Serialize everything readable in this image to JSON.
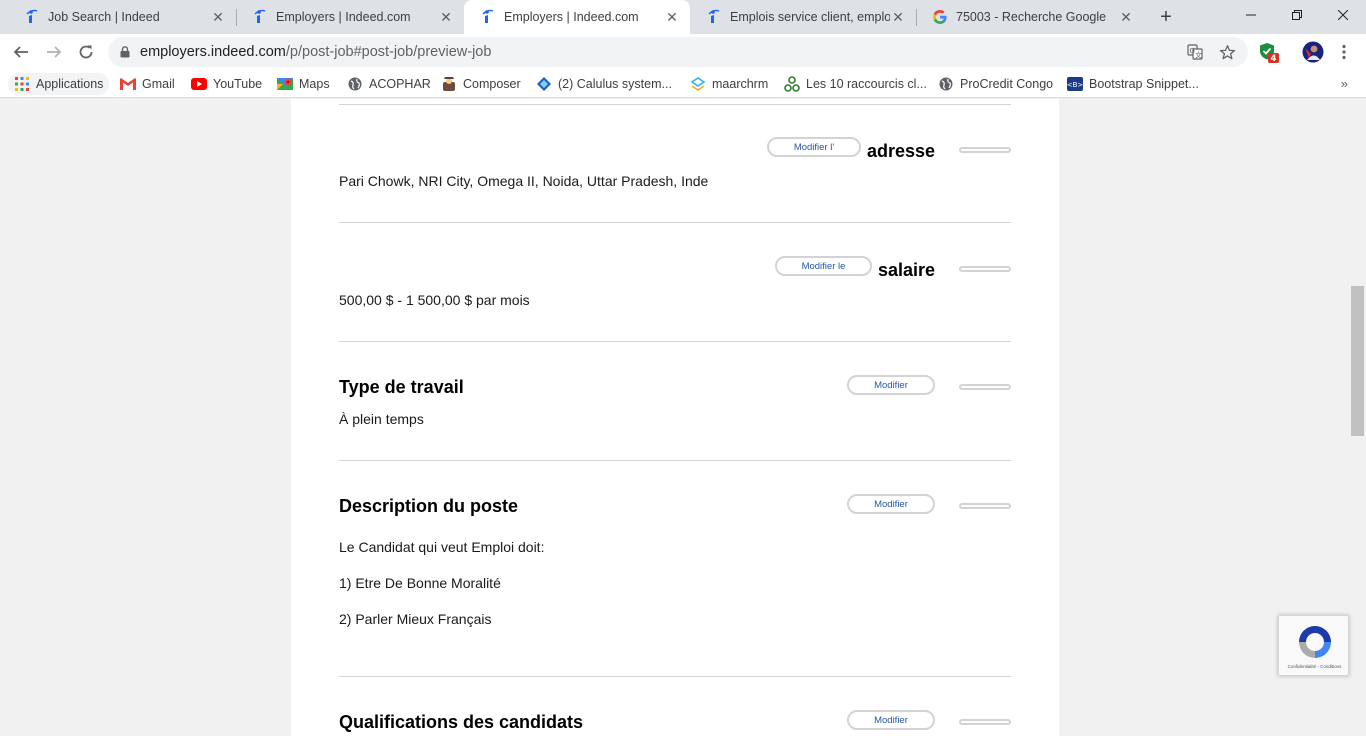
{
  "browser": {
    "tabs": [
      {
        "title": "Job Search | Indeed",
        "favicon": "indeed-icon",
        "active": false
      },
      {
        "title": "Employers | Indeed.com",
        "favicon": "indeed-icon",
        "active": false
      },
      {
        "title": "Employers | Indeed.com",
        "favicon": "indeed-icon",
        "active": true
      },
      {
        "title": "Emplois service client, emploi",
        "favicon": "indeed-icon",
        "active": false
      },
      {
        "title": "75003 - Recherche Google",
        "favicon": "google-icon",
        "active": false
      }
    ],
    "url_host": "employers.indeed.com",
    "url_path": "/p/post-job#post-job/preview-job",
    "extension_badge": "4",
    "bookmarks": [
      {
        "label": "Applications",
        "icon": "apps-grid-icon"
      },
      {
        "label": "Gmail",
        "icon": "gmail-icon"
      },
      {
        "label": "YouTube",
        "icon": "youtube-icon"
      },
      {
        "label": "Maps",
        "icon": "maps-icon"
      },
      {
        "label": "ACOPHAR",
        "icon": "globe-icon"
      },
      {
        "label": "Composer",
        "icon": "composer-icon"
      },
      {
        "label": "(2) Calulus system...",
        "icon": "calculus-icon"
      },
      {
        "label": "maarchrm",
        "icon": "maarch-icon"
      },
      {
        "label": "Les 10 raccourcis cl...",
        "icon": "tree-icon"
      },
      {
        "label": "ProCredit Congo",
        "icon": "globe-icon"
      },
      {
        "label": "Bootstrap Snippet...",
        "icon": "bootstrap-icon"
      }
    ],
    "bookmarks_more": "»"
  },
  "sections": {
    "address": {
      "title": "adresse",
      "edit_label": "Modifier l'",
      "value": "Pari Chowk, NRI City, Omega II, Noida, Uttar Pradesh, Inde"
    },
    "salary": {
      "title": "salaire",
      "edit_label": "Modifier le",
      "value": "500,00 $ - 1 500,00 $ par mois"
    },
    "job_type": {
      "title": "Type de travail",
      "edit_label": "Modifier",
      "value": "À plein temps"
    },
    "description": {
      "title": "Description du poste",
      "edit_label": "Modifier",
      "lines": [
        "Le Candidat qui veut Emploi doit:",
        "1) Etre De Bonne Moralité",
        "2) Parler Mieux Français"
      ]
    },
    "qualifications": {
      "title": "Qualifications des candidats",
      "edit_label": "Modifier"
    }
  },
  "recaptcha": {
    "text": "Confidentialité - Conditions"
  }
}
